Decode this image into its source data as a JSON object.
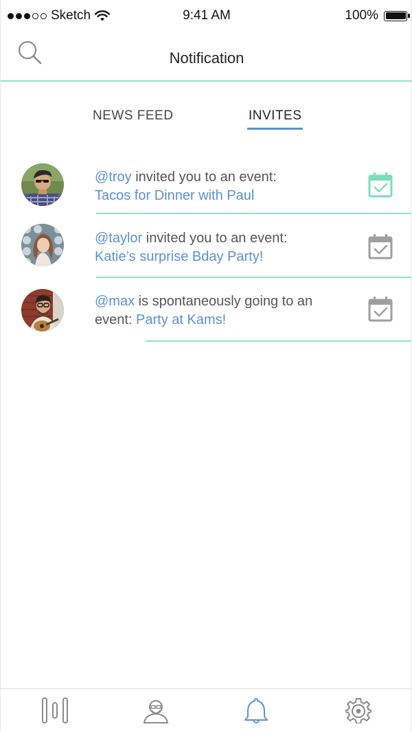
{
  "status_bar": {
    "carrier": "Sketch",
    "time": "9:41 AM",
    "battery": "100%"
  },
  "header": {
    "title": "Notification"
  },
  "tabs": [
    {
      "label": "NEWS FEED",
      "active": false
    },
    {
      "label": "INVITES",
      "active": true
    }
  ],
  "notifications": [
    {
      "user": "@troy",
      "text": " invited you to an event:",
      "event": "Tacos for Dinner with Paul",
      "calendar_state": "active"
    },
    {
      "user": "@taylor",
      "text": " invited you to an event:",
      "event": "Katie’s surprise Bday Party!",
      "calendar_state": "inactive"
    },
    {
      "user": "@max",
      "text": " is spontaneously going to an event: ",
      "event": "Party at Kams!",
      "calendar_state": "inactive"
    }
  ],
  "tab_bar": {
    "items": [
      "feed-icon",
      "profile-icon",
      "bell-icon",
      "gear-icon"
    ],
    "active": "bell-icon"
  },
  "colors": {
    "accent_blue": "#5b8fd6",
    "accent_green": "#8fe5c5",
    "calendar_active": "#7dddb9",
    "calendar_inactive": "#9e9e9e"
  }
}
